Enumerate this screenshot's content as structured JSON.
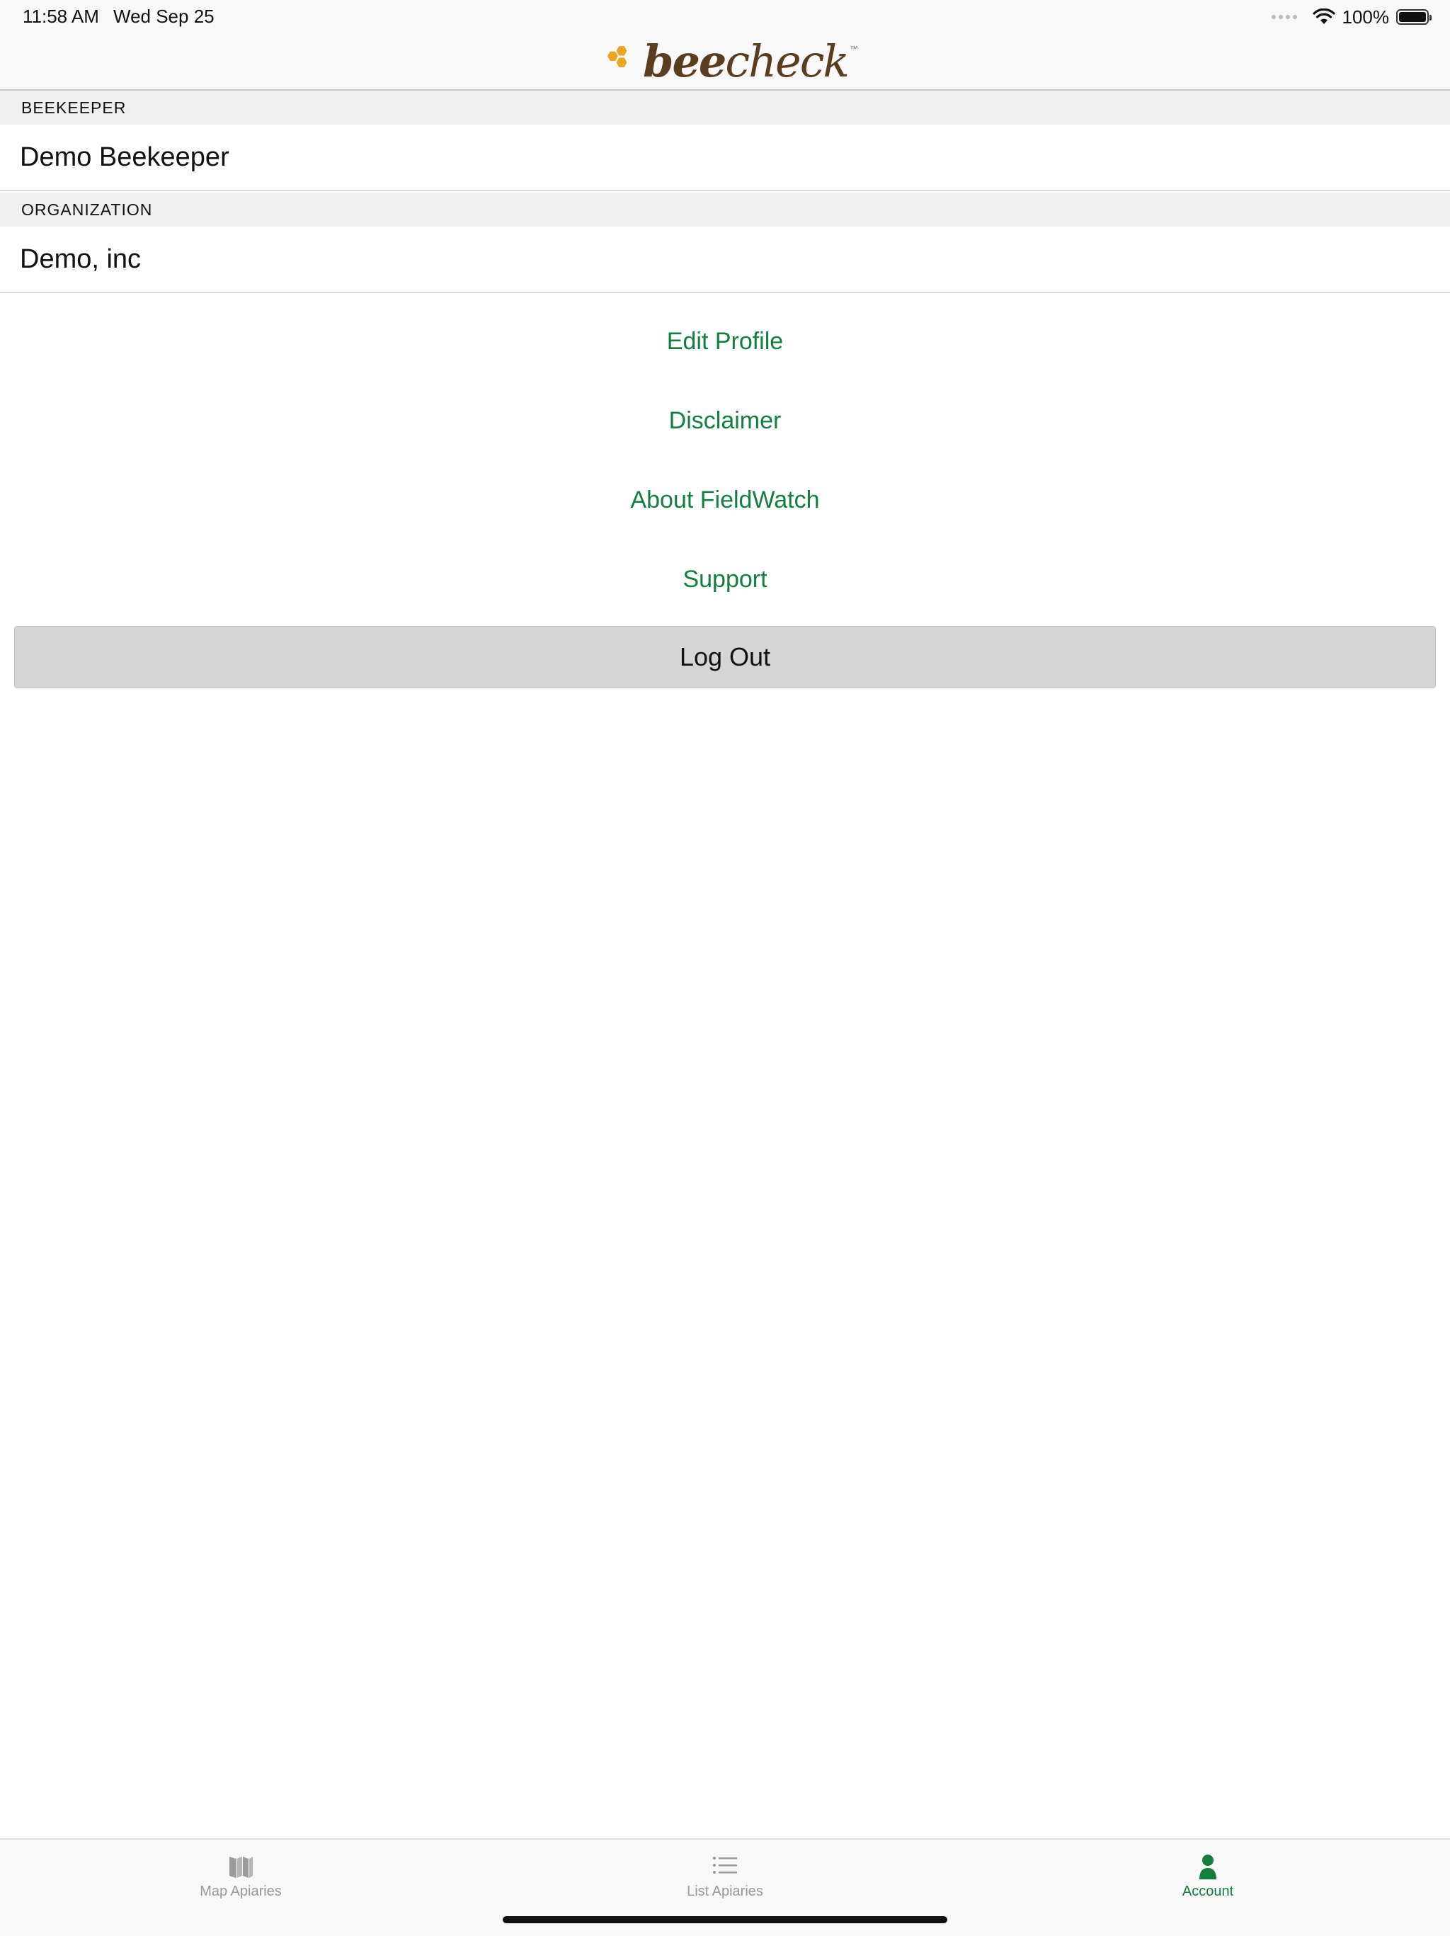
{
  "status_bar": {
    "time": "11:58 AM",
    "date": "Wed Sep 25",
    "battery": "100%"
  },
  "brand": {
    "part1": "bee",
    "part2": "check",
    "tm": "™",
    "honey_color": "#e9a623",
    "text_color": "#5a3d1e"
  },
  "beekeeper": {
    "header": "BEEKEEPER",
    "value": "Demo Beekeeper"
  },
  "organization": {
    "header": "ORGANIZATION",
    "value": "Demo, inc"
  },
  "links": {
    "edit_profile": "Edit Profile",
    "disclaimer": "Disclaimer",
    "about": "About FieldWatch",
    "support": "Support"
  },
  "logout_label": "Log Out",
  "tabs": {
    "map": {
      "label": "Map Apiaries",
      "icon": "map-icon"
    },
    "list": {
      "label": "List Apiaries",
      "icon": "list-icon"
    },
    "account": {
      "label": "Account",
      "icon": "person-icon"
    }
  },
  "colors": {
    "accent": "#127f3d",
    "inactive": "#999999"
  }
}
